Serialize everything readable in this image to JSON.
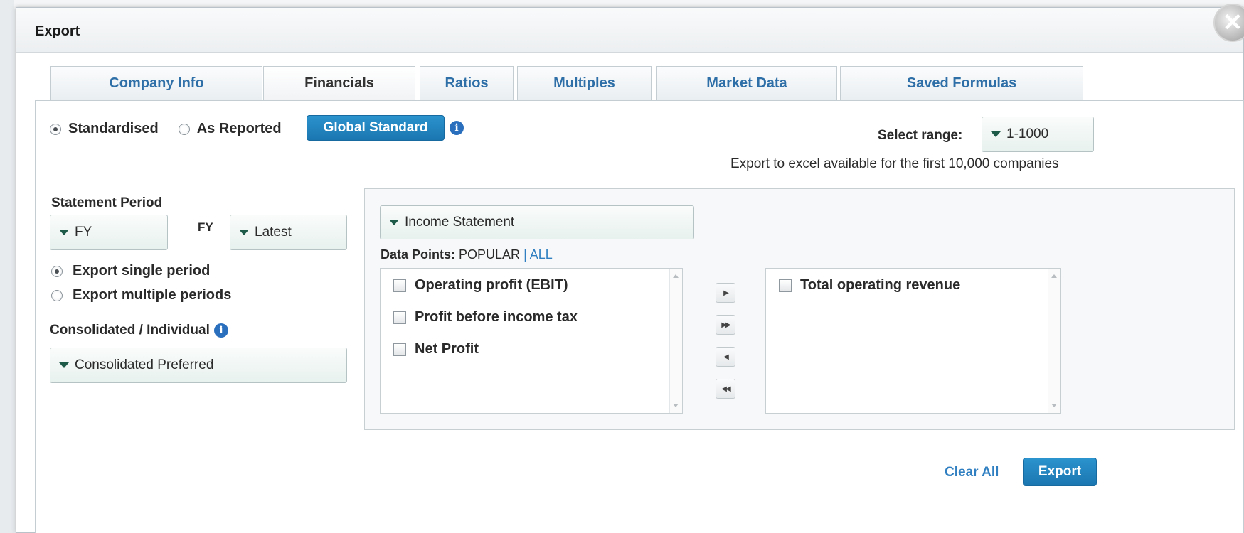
{
  "dialog": {
    "title": "Export",
    "close_glyph": "✕"
  },
  "tabs": [
    {
      "label": "Company Info"
    },
    {
      "label": "Financials"
    },
    {
      "label": "Ratios"
    },
    {
      "label": "Multiples"
    },
    {
      "label": "Market Data"
    },
    {
      "label": "Saved Formulas"
    }
  ],
  "active_tab": "Financials",
  "standard": {
    "standardised": "Standardised",
    "as_reported": "As Reported",
    "selected": "Standardised",
    "global_button": "Global Standard",
    "info_glyph": "i"
  },
  "range": {
    "label": "Select range:",
    "value": "1-1000",
    "note": "Export to excel available for the first 10,000 companies"
  },
  "statement_period": {
    "heading": "Statement Period",
    "period_type": "FY",
    "fy_label": "FY",
    "fy_value": "Latest",
    "single": "Export single period",
    "multiple": "Export multiple periods",
    "selected": "Export single period"
  },
  "consolidation": {
    "heading": "Consolidated / Individual",
    "value": "Consolidated Preferred"
  },
  "data_points": {
    "statement": "Income Statement",
    "label": "Data Points:",
    "popular": "POPULAR",
    "separator": "|",
    "all": "ALL",
    "available": [
      {
        "label": "Operating profit (EBIT)"
      },
      {
        "label": "Profit before income tax"
      },
      {
        "label": "Net Profit"
      }
    ],
    "selected": [
      {
        "label": "Total operating revenue"
      }
    ],
    "move_buttons": [
      "▶",
      "▶▶",
      "◀",
      "◀◀"
    ]
  },
  "footer": {
    "clear_all": "Clear All",
    "export": "Export"
  },
  "colors": {
    "accent_blue": "#1b76b0",
    "tab_text": "#2f6fa8",
    "link_blue": "#2f7fc1",
    "dropdown_caret": "#1e5a48"
  }
}
